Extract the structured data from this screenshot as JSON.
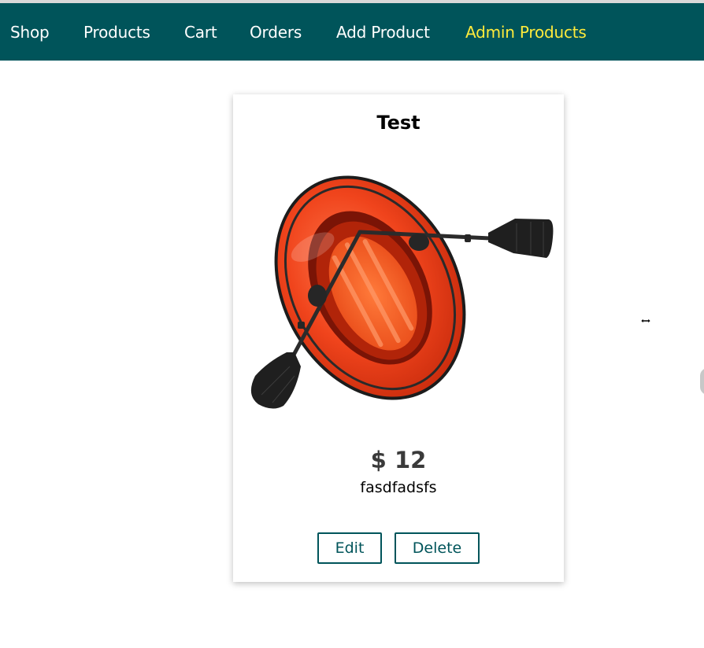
{
  "nav": {
    "items": [
      {
        "label": "Shop",
        "active": false
      },
      {
        "label": "Products",
        "active": false
      },
      {
        "label": "Cart",
        "active": false
      },
      {
        "label": "Orders",
        "active": false
      },
      {
        "label": "Add Product",
        "active": false
      },
      {
        "label": "Admin Products",
        "active": true
      }
    ]
  },
  "product": {
    "title": "Test",
    "image_icon": "inflatable-raft-with-oars",
    "price": "$ 12",
    "description": "fasdfadsfs",
    "edit_label": "Edit",
    "delete_label": "Delete"
  },
  "colors": {
    "header_bg": "#00545a",
    "active_nav": "#ffeb3b",
    "button_accent": "#00545a"
  }
}
